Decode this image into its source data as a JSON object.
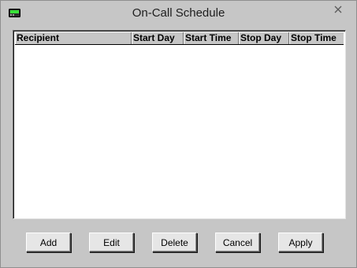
{
  "window": {
    "title": "On-Call Schedule",
    "app_icon": "pager-icon",
    "close_icon": "close-icon"
  },
  "list": {
    "columns": [
      "Recipient",
      "Start Day",
      "Start Time",
      "Stop Day",
      "Stop Time"
    ],
    "rows": []
  },
  "buttons": {
    "add": "Add",
    "edit": "Edit",
    "delete": "Delete",
    "cancel": "Cancel",
    "apply": "Apply"
  }
}
